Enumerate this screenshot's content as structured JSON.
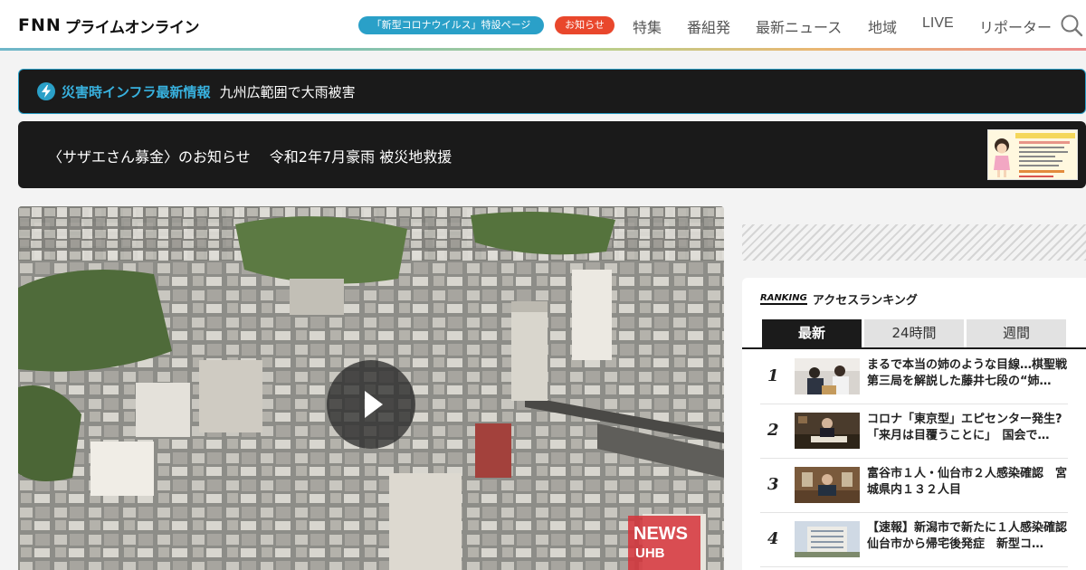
{
  "header": {
    "logo": {
      "fnn": "FNN",
      "jp": "プライムオンライン"
    },
    "corona_pill": "「新型コロナウイルス」特設ページ",
    "notice_pill": "お知らせ",
    "nav": [
      "特集",
      "番組発",
      "最新ニュース",
      "地域",
      "LIVE",
      "リポーター"
    ]
  },
  "disaster_banner": {
    "label": "災害時インフラ最新情報",
    "text": "九州広範囲で大雨被害"
  },
  "sazae_banner": {
    "text": "〈サザエさん募金〉のお知らせ　 令和2年7月豪雨 被災地救援"
  },
  "video": {
    "watermark": "NEWS UHB"
  },
  "ranking": {
    "badge": "RANKING",
    "title": "アクセスランキング",
    "tabs": [
      "最新",
      "24時間",
      "週間"
    ],
    "active_tab": "最新",
    "items": [
      {
        "rank": "1",
        "title": "まるで本当の姉のような目線…棋聖戦第三局を解説した藤井七段の“姉…"
      },
      {
        "rank": "2",
        "title": "コロナ「東京型」エピセンター発生? 「来月は目覆うことに」　国会で…"
      },
      {
        "rank": "3",
        "title": "富谷市１人・仙台市２人感染確認　宮城県内１３２人目"
      },
      {
        "rank": "4",
        "title": "【速報】新潟市で新たに１人感染確認　仙台市から帰宅後発症　新型コ…"
      }
    ]
  },
  "colors": {
    "accent_blue": "#2aa0c8",
    "notice_red": "#e9472c",
    "banner_bg": "#1a1a1a"
  }
}
